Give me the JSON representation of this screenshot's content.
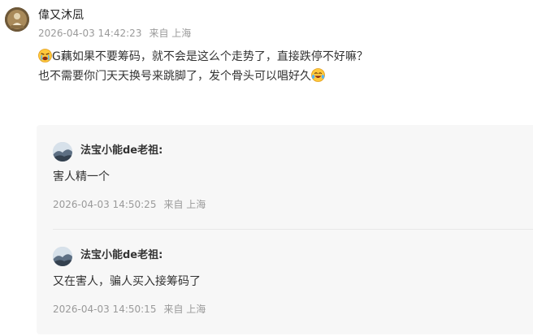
{
  "post": {
    "author": "偉又沐凨",
    "timestamp": "2026-04-03 14:42:23",
    "source": "来自 上海",
    "text_line1": "G藕如果不要筹码，就不会是这么个走势了，直接跌停不好嘛？",
    "text_line2": "也不需要你门天天换号来跳脚了，发个骨头可以唱好久",
    "emoji_start": "sob-emoji-icon",
    "emoji_end": "laugh-cry-emoji-icon"
  },
  "replies": [
    {
      "author": "法宝小能de老祖:",
      "text": "害人精一个",
      "timestamp": "2026-04-03 14:50:25",
      "source": "来自 上海"
    },
    {
      "author": "法宝小能de老祖:",
      "text": "又在害人，骗人买入接筹码了",
      "timestamp": "2026-04-03 14:50:15",
      "source": "来自 上海"
    }
  ],
  "colors": {
    "meta": "#9a9a9a",
    "text": "#333333",
    "reply_background": "#f7f7f7"
  }
}
